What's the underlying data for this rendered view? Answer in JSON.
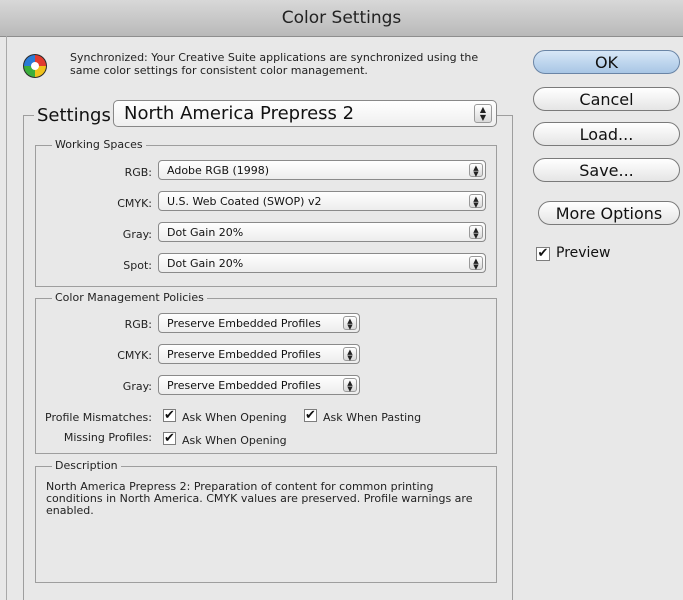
{
  "window": {
    "title": "Color Settings"
  },
  "sync": {
    "icon": "color-wheel-icon",
    "message": "Synchronized: Your Creative Suite applications are synchronized using the same color settings for consistent color management."
  },
  "buttons": {
    "ok": "OK",
    "cancel": "Cancel",
    "load": "Load...",
    "save": "Save...",
    "more_options": "More Options"
  },
  "preview": {
    "label": "Preview",
    "checked": true
  },
  "settings": {
    "label": "Settings:",
    "value": "North America Prepress 2"
  },
  "working_spaces": {
    "title": "Working Spaces",
    "rgb": {
      "label": "RGB:",
      "value": "Adobe RGB (1998)"
    },
    "cmyk": {
      "label": "CMYK:",
      "value": "U.S. Web Coated (SWOP) v2"
    },
    "gray": {
      "label": "Gray:",
      "value": "Dot Gain 20%"
    },
    "spot": {
      "label": "Spot:",
      "value": "Dot Gain 20%"
    }
  },
  "policies": {
    "title": "Color Management Policies",
    "rgb": {
      "label": "RGB:",
      "value": "Preserve Embedded Profiles"
    },
    "cmyk": {
      "label": "CMYK:",
      "value": "Preserve Embedded Profiles"
    },
    "gray": {
      "label": "Gray:",
      "value": "Preserve Embedded Profiles"
    },
    "profile_mismatches": {
      "label": "Profile Mismatches:",
      "ask_opening": "Ask When Opening",
      "ask_pasting": "Ask When Pasting",
      "opening_checked": true,
      "pasting_checked": true
    },
    "missing_profiles": {
      "label": "Missing Profiles:",
      "ask_opening": "Ask When Opening",
      "opening_checked": true
    }
  },
  "description": {
    "title": "Description",
    "text": "North America Prepress 2:  Preparation of content for common printing conditions in North America. CMYK values are preserved. Profile warnings are enabled."
  }
}
